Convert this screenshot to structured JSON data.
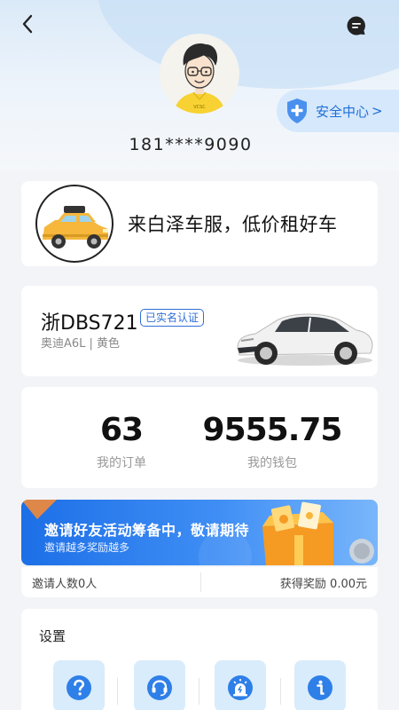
{
  "header": {
    "phone": "181****9090",
    "safety_center_label": "安全中心",
    "safety_center_chevron": ">",
    "avatar_shirt_text": "VCSC"
  },
  "banner": {
    "text": "来白泽车服，低价租好车"
  },
  "vehicle": {
    "plate": "浙DBS721",
    "verify_badge": "已实名认证",
    "description": "奥迪A6L | 黄色"
  },
  "stats": {
    "orders_value": "63",
    "orders_label": "我的订单",
    "wallet_value": "9555.75",
    "wallet_label": "我的钱包"
  },
  "invite": {
    "title": "邀请好友活动筹备中，敬请期待",
    "subtitle": "邀请越多奖励越多",
    "count_text": "邀请人数0人",
    "reward_text": "获得奖励  0.00元"
  },
  "settings": {
    "title": "设置"
  },
  "colors": {
    "accent": "#1f6fd9",
    "icon_bg": "#d9ecfb",
    "taxi_yellow": "#f6b73c"
  }
}
